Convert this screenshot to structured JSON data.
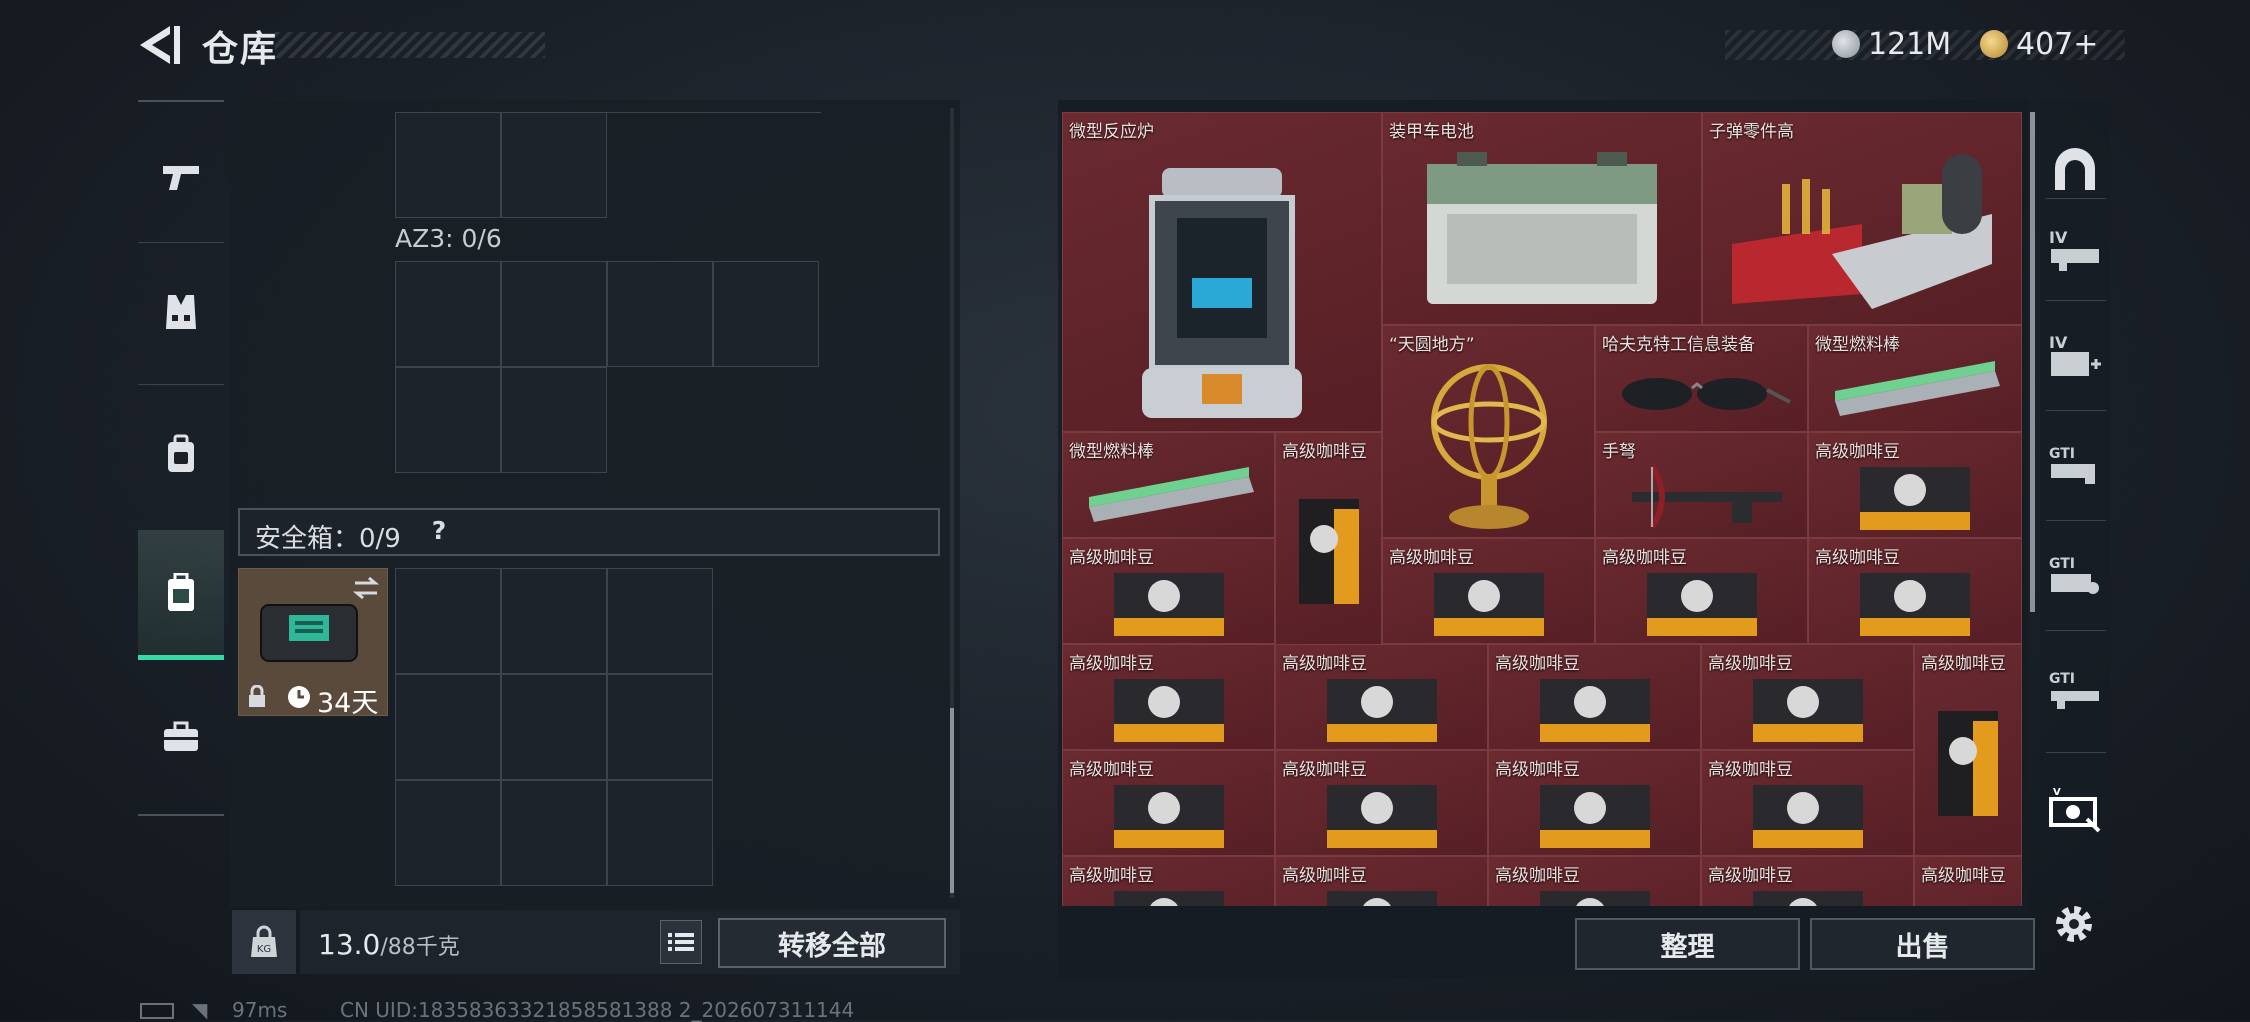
{
  "header": {
    "title": "仓库"
  },
  "currency": {
    "silver": "121M",
    "gold": "407+"
  },
  "left_nav": {
    "items": [
      {
        "name": "weapons-tab",
        "icon": "pistol-icon"
      },
      {
        "name": "armor-tab",
        "icon": "vest-icon"
      },
      {
        "name": "backpack-tab",
        "icon": "backpack-icon"
      },
      {
        "name": "safebox-tab",
        "icon": "case-icon",
        "active": true
      },
      {
        "name": "toolbox-tab",
        "icon": "briefcase-icon"
      }
    ]
  },
  "loadout": {
    "az3_label": "AZ3: 0/6",
    "safe_box_label": "安全箱：0/9",
    "help_symbol": "?",
    "case_timer": "34天",
    "weight": "13.0",
    "weight_unit": "/88千克",
    "transfer_all": "转移全部"
  },
  "storage": {
    "items": [
      {
        "name": "微型反应炉"
      },
      {
        "name": "装甲车电池"
      },
      {
        "name": "子弹零件高"
      },
      {
        "name": "“天圆地方”"
      },
      {
        "name": "哈夫克特工信息装备"
      },
      {
        "name": "微型燃料棒"
      },
      {
        "name": "微型燃料棒"
      },
      {
        "name": "高级咖啡豆"
      },
      {
        "name": "手弩"
      },
      {
        "name": "高级咖啡豆"
      },
      {
        "name": "高级咖啡豆"
      },
      {
        "name": "高级咖啡豆"
      },
      {
        "name": "高级咖啡豆"
      },
      {
        "name": "高级咖啡豆"
      },
      {
        "name": "高级咖啡豆"
      },
      {
        "name": "高级咖啡豆"
      },
      {
        "name": "高级咖啡豆"
      },
      {
        "name": "高级咖啡豆"
      },
      {
        "name": "高级咖啡豆"
      },
      {
        "name": "高级咖啡豆"
      },
      {
        "name": "高级咖啡豆"
      },
      {
        "name": "高级咖啡豆"
      },
      {
        "name": "高级咖啡豆"
      },
      {
        "name": "高级咖啡豆"
      },
      {
        "name": "高级咖啡豆"
      },
      {
        "name": "高级咖啡豆"
      },
      {
        "name": "高级咖啡豆"
      },
      {
        "name": "高级咖啡豆"
      },
      {
        "name": "高级咖啡豆"
      }
    ],
    "sort_label": "整理",
    "sell_label": "出售"
  },
  "right_tabs": [
    {
      "name": "tab-all",
      "icon": "arch-icon"
    },
    {
      "name": "tab-iv-1",
      "icon": "iv-weapon-icon"
    },
    {
      "name": "tab-iv-2",
      "icon": "iv-medical-icon"
    },
    {
      "name": "tab-gti-1",
      "icon": "gti-weapon-icon"
    },
    {
      "name": "tab-gti-2",
      "icon": "gti-ammo-icon"
    },
    {
      "name": "tab-gti-3",
      "icon": "gti-rifle-icon"
    },
    {
      "name": "tab-collectibles",
      "icon": "valuables-icon"
    }
  ],
  "status": {
    "ping": "97ms",
    "uid": "CN UID:18358363321858581388 2_202607311144"
  },
  "colors": {
    "accent": "#37d9a2",
    "item_bg": "#5a2529",
    "panel_bg": "#181e25"
  }
}
